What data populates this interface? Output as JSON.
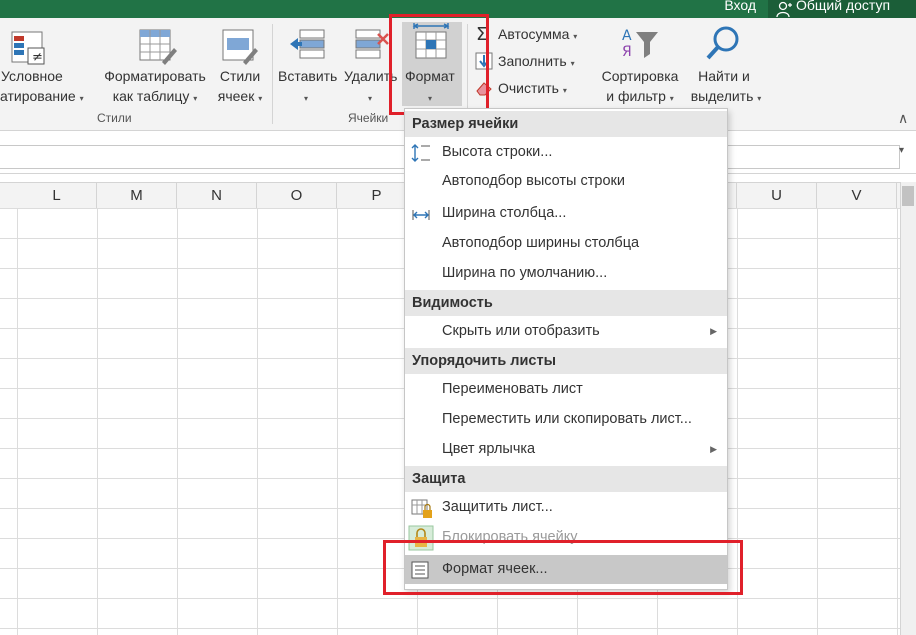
{
  "titlebar": {
    "login": "Вход",
    "share": "Общий доступ"
  },
  "ribbon": {
    "cond_format_l1": "Условное",
    "cond_format_l2": "атирование",
    "table_l1": "Форматировать",
    "table_l2": "как таблицу",
    "styles_l1": "Стили",
    "styles_l2": "ячеек",
    "insert": "Вставить",
    "delete": "Удалить",
    "format": "Формат",
    "autosum": "Автосумма",
    "fill": "Заполнить",
    "clear": "Очистить",
    "sort_l1": "Сортировка",
    "sort_l2": "и фильтр",
    "find_l1": "Найти и",
    "find_l2": "выделить",
    "group_styles": "Стили",
    "group_cells": "Ячейки",
    "caret": "▾",
    "collapse": "∧"
  },
  "columns": [
    "L",
    "M",
    "N",
    "O",
    "P",
    "U",
    "V"
  ],
  "menu": {
    "h_size": "Размер ячейки",
    "row_height": "Высота строки...",
    "autofit_row": "Автоподбор высоты строки",
    "col_width": "Ширина столбца...",
    "autofit_col": "Автоподбор ширины столбца",
    "default_width": "Ширина по умолчанию...",
    "h_visibility": "Видимость",
    "hide_show": "Скрыть или отобразить",
    "h_sheets": "Упорядочить листы",
    "rename": "Переименовать лист",
    "move_copy": "Переместить или скопировать лист...",
    "tab_color": "Цвет ярлычка",
    "h_protect": "Защита",
    "protect_sheet": "Защитить лист...",
    "lock_cell": "Блокировать ячейку",
    "format_cells": "Формат ячеек...",
    "submenu_arrow": "▶"
  },
  "colors": {
    "brand_green": "#217346",
    "highlight_red": "#e0202a"
  }
}
